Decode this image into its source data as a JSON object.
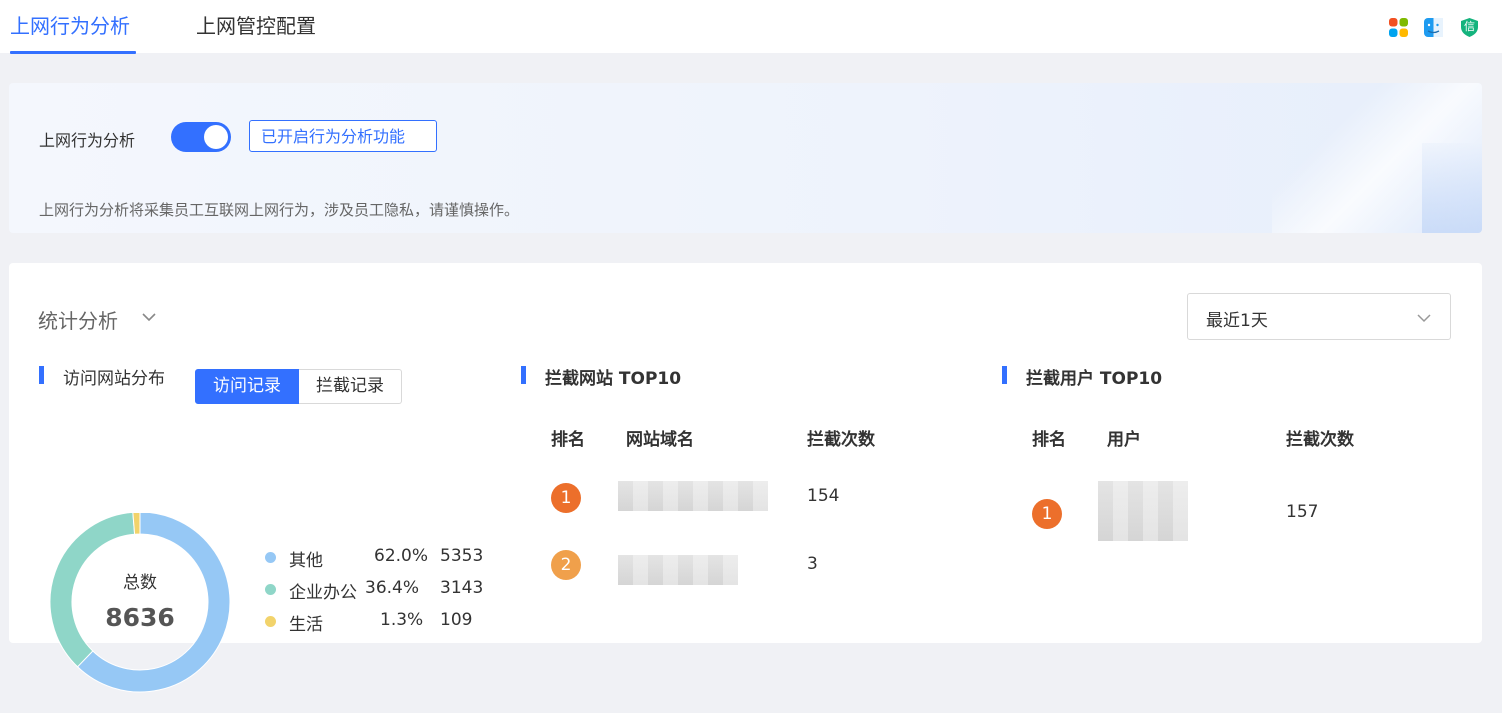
{
  "tabs": [
    {
      "label": "上网行为分析",
      "active": true
    },
    {
      "label": "上网管控配置",
      "active": false
    }
  ],
  "top_icons": [
    "apps-grid-icon",
    "finder-face-icon",
    "shield-xin-icon"
  ],
  "shield_icon_char": "信",
  "banner": {
    "label": "上网行为分析",
    "toggle_on": true,
    "status": "已开启行为分析功能",
    "note": "上网行为分析将采集员工互联网上网行为，涉及员工隐私，请谨慎操作。"
  },
  "stats": {
    "title": "统计分析",
    "range": "最近1天",
    "distribution": {
      "title": "访问网站分布",
      "seg": [
        "访问记录",
        "拦截记录"
      ],
      "total_label": "总数",
      "total": "8636",
      "legend": [
        {
          "name": "其他",
          "pct": "62.0%",
          "value": "5353",
          "color": "#96c8f5"
        },
        {
          "name": "企业办公",
          "pct": "36.4%",
          "value": "3143",
          "color": "#8fd6c8"
        },
        {
          "name": "生活",
          "pct": "1.3%",
          "value": "109",
          "color": "#f2d36b"
        }
      ]
    },
    "blocked_sites": {
      "title": "拦截网站 TOP10",
      "headers": [
        "排名",
        "网站域名",
        "拦截次数"
      ],
      "rows": [
        {
          "rank": "1",
          "count": "154"
        },
        {
          "rank": "2",
          "count": "3"
        }
      ]
    },
    "blocked_users": {
      "title": "拦截用户 TOP10",
      "headers": [
        "排名",
        "用户",
        "拦截次数"
      ],
      "rows": [
        {
          "rank": "1",
          "count": "157"
        }
      ]
    }
  },
  "colors": {
    "accent": "#3370ff",
    "rank1": "#ec6f2b",
    "rank2": "#f0a04b"
  }
}
